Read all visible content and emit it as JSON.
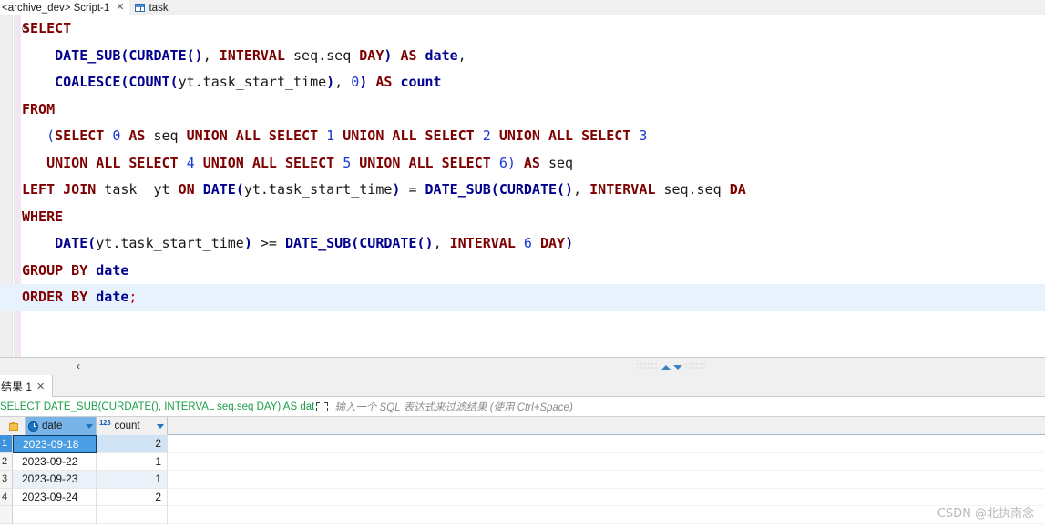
{
  "editor_tabs": [
    {
      "label": "<archive_dev> Script-1",
      "active": true,
      "closable": true,
      "icon": null
    },
    {
      "label": "task",
      "active": false,
      "closable": false,
      "icon": "table-icon"
    }
  ],
  "code": {
    "lines": [
      [
        {
          "t": "SELECT",
          "c": "kw"
        }
      ],
      [
        {
          "t": "    ",
          "c": "pun"
        },
        {
          "t": "DATE_SUB",
          "c": "fn"
        },
        {
          "t": "(",
          "c": "fn"
        },
        {
          "t": "CURDATE",
          "c": "fn"
        },
        {
          "t": "()",
          "c": "fn"
        },
        {
          "t": ", ",
          "c": "pun"
        },
        {
          "t": "INTERVAL",
          "c": "kw"
        },
        {
          "t": " seq.seq ",
          "c": "id"
        },
        {
          "t": "DAY",
          "c": "kw"
        },
        {
          "t": ")",
          "c": "fn"
        },
        {
          "t": " ",
          "c": "pun"
        },
        {
          "t": "AS",
          "c": "kw"
        },
        {
          "t": " ",
          "c": "pun"
        },
        {
          "t": "date",
          "c": "col"
        },
        {
          "t": ",",
          "c": "pun"
        }
      ],
      [
        {
          "t": "    ",
          "c": "pun"
        },
        {
          "t": "COALESCE",
          "c": "fn"
        },
        {
          "t": "(",
          "c": "fn"
        },
        {
          "t": "COUNT",
          "c": "fn"
        },
        {
          "t": "(",
          "c": "fn"
        },
        {
          "t": "yt.task_start_time",
          "c": "id"
        },
        {
          "t": ")",
          "c": "fn"
        },
        {
          "t": ", ",
          "c": "pun"
        },
        {
          "t": "0",
          "c": "num"
        },
        {
          "t": ")",
          "c": "fn"
        },
        {
          "t": " ",
          "c": "pun"
        },
        {
          "t": "AS",
          "c": "kw"
        },
        {
          "t": " ",
          "c": "pun"
        },
        {
          "t": "count",
          "c": "col"
        }
      ],
      [
        {
          "t": "FROM",
          "c": "kw"
        }
      ],
      [
        {
          "t": "   ",
          "c": "pun"
        },
        {
          "t": "(",
          "c": "num"
        },
        {
          "t": "SELECT",
          "c": "kw"
        },
        {
          "t": " ",
          "c": "pun"
        },
        {
          "t": "0",
          "c": "num"
        },
        {
          "t": " ",
          "c": "pun"
        },
        {
          "t": "AS",
          "c": "kw"
        },
        {
          "t": " seq ",
          "c": "id"
        },
        {
          "t": "UNION ALL SELECT",
          "c": "kw"
        },
        {
          "t": " ",
          "c": "pun"
        },
        {
          "t": "1",
          "c": "num"
        },
        {
          "t": " ",
          "c": "pun"
        },
        {
          "t": "UNION ALL SELECT",
          "c": "kw"
        },
        {
          "t": " ",
          "c": "pun"
        },
        {
          "t": "2",
          "c": "num"
        },
        {
          "t": " ",
          "c": "pun"
        },
        {
          "t": "UNION ALL SELECT",
          "c": "kw"
        },
        {
          "t": " ",
          "c": "pun"
        },
        {
          "t": "3",
          "c": "num"
        }
      ],
      [
        {
          "t": "   ",
          "c": "pun"
        },
        {
          "t": "UNION ALL SELECT",
          "c": "kw"
        },
        {
          "t": " ",
          "c": "pun"
        },
        {
          "t": "4",
          "c": "num"
        },
        {
          "t": " ",
          "c": "pun"
        },
        {
          "t": "UNION ALL SELECT",
          "c": "kw"
        },
        {
          "t": " ",
          "c": "pun"
        },
        {
          "t": "5",
          "c": "num"
        },
        {
          "t": " ",
          "c": "pun"
        },
        {
          "t": "UNION ALL SELECT",
          "c": "kw"
        },
        {
          "t": " ",
          "c": "pun"
        },
        {
          "t": "6",
          "c": "num"
        },
        {
          "t": ")",
          "c": "num"
        },
        {
          "t": " ",
          "c": "pun"
        },
        {
          "t": "AS",
          "c": "kw"
        },
        {
          "t": " seq",
          "c": "id"
        }
      ],
      [
        {
          "t": "LEFT JOIN",
          "c": "kw"
        },
        {
          "t": " task  yt ",
          "c": "id"
        },
        {
          "t": "ON",
          "c": "kw"
        },
        {
          "t": " ",
          "c": "pun"
        },
        {
          "t": "DATE",
          "c": "fn"
        },
        {
          "t": "(",
          "c": "fn"
        },
        {
          "t": "yt.task_start_time",
          "c": "id"
        },
        {
          "t": ")",
          "c": "fn"
        },
        {
          "t": " = ",
          "c": "pun"
        },
        {
          "t": "DATE_SUB",
          "c": "fn"
        },
        {
          "t": "(",
          "c": "fn"
        },
        {
          "t": "CURDATE",
          "c": "fn"
        },
        {
          "t": "()",
          "c": "fn"
        },
        {
          "t": ", ",
          "c": "pun"
        },
        {
          "t": "INTERVAL",
          "c": "kw"
        },
        {
          "t": " seq.seq ",
          "c": "id"
        },
        {
          "t": "DA",
          "c": "kw"
        }
      ],
      [
        {
          "t": "WHERE",
          "c": "kw"
        }
      ],
      [
        {
          "t": "    ",
          "c": "pun"
        },
        {
          "t": "DATE",
          "c": "fn"
        },
        {
          "t": "(",
          "c": "fn"
        },
        {
          "t": "yt.task_start_time",
          "c": "id"
        },
        {
          "t": ")",
          "c": "fn"
        },
        {
          "t": " >= ",
          "c": "pun"
        },
        {
          "t": "DATE_SUB",
          "c": "fn"
        },
        {
          "t": "(",
          "c": "fn"
        },
        {
          "t": "CURDATE",
          "c": "fn"
        },
        {
          "t": "()",
          "c": "fn"
        },
        {
          "t": ", ",
          "c": "pun"
        },
        {
          "t": "INTERVAL",
          "c": "kw"
        },
        {
          "t": " ",
          "c": "pun"
        },
        {
          "t": "6",
          "c": "num"
        },
        {
          "t": " ",
          "c": "pun"
        },
        {
          "t": "DAY",
          "c": "kw"
        },
        {
          "t": ")",
          "c": "fn"
        }
      ],
      [
        {
          "t": "GROUP BY",
          "c": "kw"
        },
        {
          "t": " ",
          "c": "pun"
        },
        {
          "t": "date",
          "c": "col"
        }
      ],
      [
        {
          "t": "ORDER BY",
          "c": "kw"
        },
        {
          "t": " ",
          "c": "pun"
        },
        {
          "t": "date",
          "c": "col"
        },
        {
          "t": ";",
          "c": "semi"
        }
      ]
    ],
    "current_line_index": 10
  },
  "splitter": {
    "collapse_icon": "chevron-left-icon",
    "maximize_icon": "chevron-up-icon",
    "minimize_icon": "chevron-down-icon"
  },
  "results": {
    "tab_label": "结果 1",
    "close_label": "✕"
  },
  "filter": {
    "sql_text": "SELECT DATE_SUB(CURDATE(), INTERVAL seq.seq DAY) AS dat",
    "expand_icon": "expand-icon",
    "placeholder": "输入一个 SQL 表达式来过滤结果 (使用 Ctrl+Space)"
  },
  "grid": {
    "columns": [
      {
        "name": "date",
        "icon": "clock-icon",
        "type": "date",
        "selected": true
      },
      {
        "name": "count",
        "icon": "number-icon",
        "type": "numeric",
        "selected": false
      }
    ],
    "rows": [
      {
        "n": "1",
        "date": "2023-09-18",
        "count": "2",
        "selected": true
      },
      {
        "n": "2",
        "date": "2023-09-22",
        "count": "1",
        "selected": false
      },
      {
        "n": "3",
        "date": "2023-09-23",
        "count": "1",
        "selected": false
      },
      {
        "n": "4",
        "date": "2023-09-24",
        "count": "2",
        "selected": false
      }
    ],
    "lock_icon": "lock-icon"
  },
  "watermark": "CSDN @北执南念"
}
